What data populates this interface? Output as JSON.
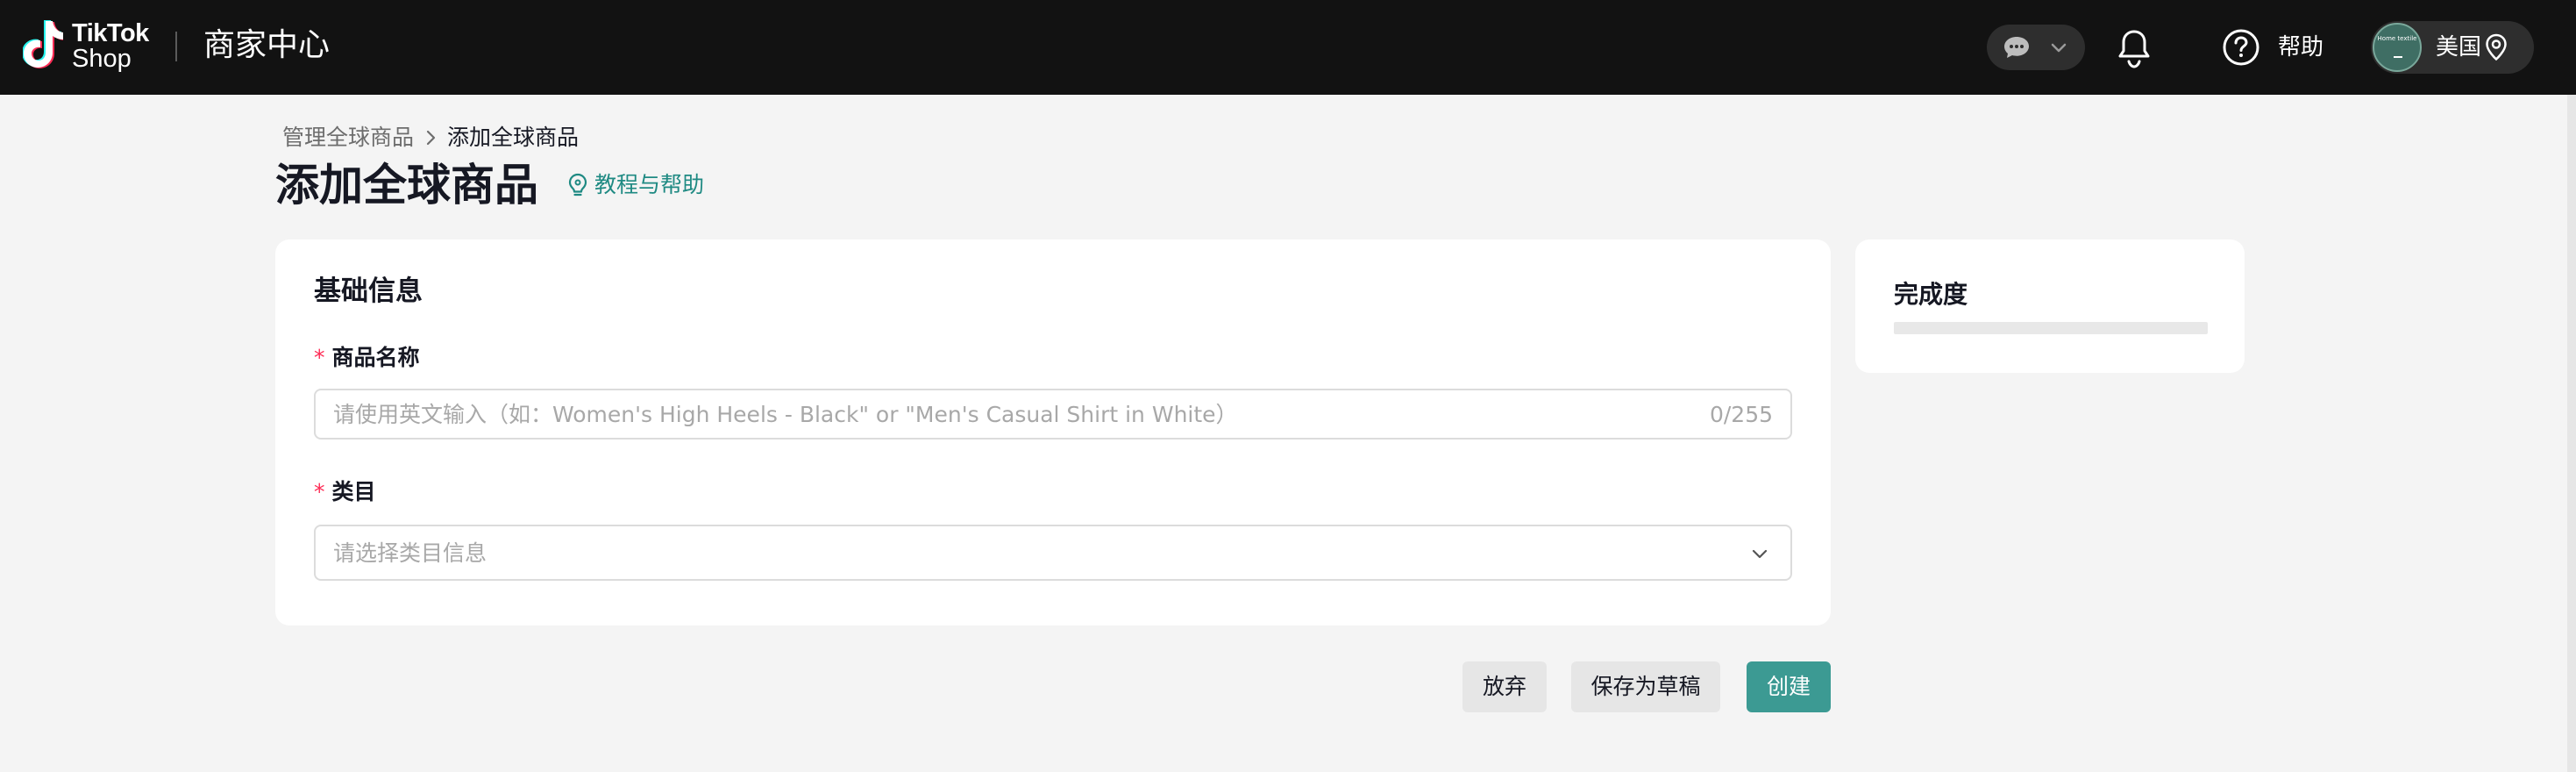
{
  "header": {
    "logo_line1": "TikTok",
    "logo_line2": "Shop",
    "app_title": "商家中心",
    "help_label": "帮助",
    "avatar_text": "Home textile",
    "region_label": "美国"
  },
  "breadcrumb": {
    "parent": "管理全球商品",
    "current": "添加全球商品"
  },
  "page": {
    "title": "添加全球商品",
    "tutorial_link": "教程与帮助"
  },
  "basic_info": {
    "section_title": "基础信息",
    "product_name": {
      "required_mark": "*",
      "label": "商品名称",
      "placeholder": "请使用英文输入（如：Women's High Heels - Black\" or \"Men's Casual Shirt in White）",
      "counter": "0/255"
    },
    "category": {
      "required_mark": "*",
      "label": "类目",
      "placeholder": "请选择类目信息"
    }
  },
  "completion": {
    "title": "完成度",
    "progress": 0
  },
  "actions": {
    "discard": "放弃",
    "save_draft": "保存为草稿",
    "create": "创建"
  },
  "colors": {
    "accent": "#1f8a83",
    "primary_button": "#3c9a93",
    "required": "#fe2c55",
    "topbar": "#121212"
  },
  "icons": {
    "logo": "tiktok-note-icon",
    "chat": "chat-bubble-icon",
    "notifications": "bell-icon",
    "help": "question-circle-icon",
    "region": "location-pin-icon",
    "tutorial": "lightbulb-icon",
    "breadcrumb_separator": "chevron-right-icon",
    "select": "chevron-down-icon"
  }
}
